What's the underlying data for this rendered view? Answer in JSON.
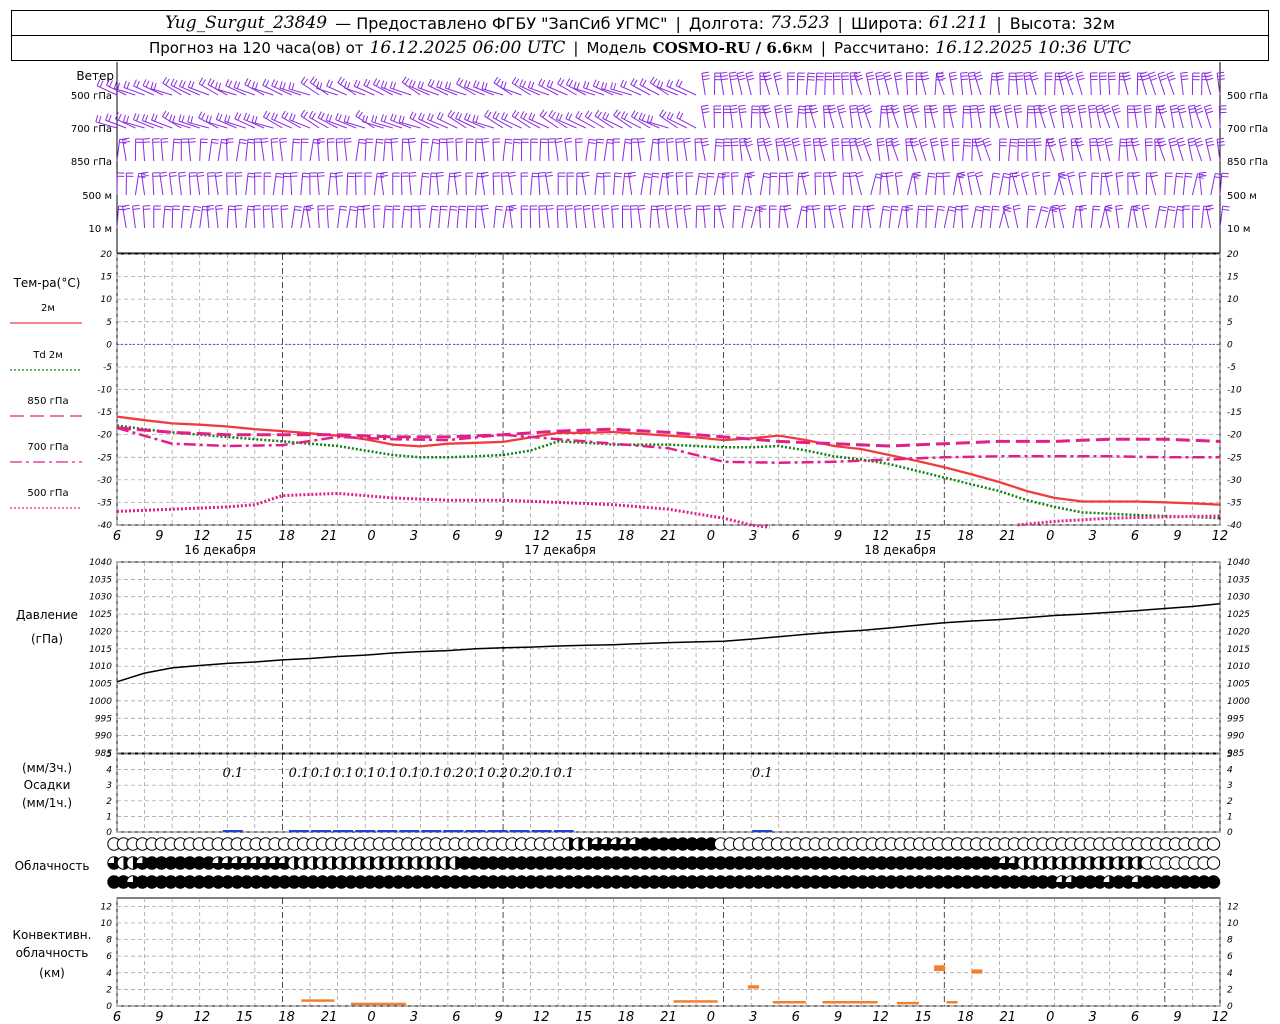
{
  "header": {
    "station": "Yug_Surgut_23849",
    "provider": "— Предоставлено ФГБУ \"ЗапСиб УГМС\"",
    "lon_label": "Долгота:",
    "lon": "73.523",
    "lat_label": "Широта:",
    "lat": "61.211",
    "alt_label": "Высота:",
    "alt": "32м",
    "forecast_prefix": "Прогноз на 120 часа(ов) от",
    "forecast_start": "16.12.2025 06:00 UTC",
    "model_label": "Модель",
    "model": "COSMO-RU / 6.6",
    "model_unit": "км",
    "computed_label": "Рассчитано:",
    "computed": "16.12.2025 10:36 UTC"
  },
  "labels": {
    "wind_title": "Ветер",
    "wind_levels": [
      "500 гПа",
      "700 гПа",
      "850 гПа",
      "500 м",
      "10 м"
    ],
    "temp_title": "Тем-ра(°C)",
    "t2m": "2м",
    "td_sym": "Td",
    "td_lvl": "2м",
    "t850": "850 гПа",
    "t700": "700 гПа",
    "t500": "500 гПа",
    "pressure_title": "Давление",
    "pressure_unit": "(гПа)",
    "precip_unit3": "(мм/3ч.)",
    "precip_title": "Осадки",
    "precip_unit1": "(мм/1ч.)",
    "cloud_title": "Облачность",
    "conv_title1": "Конвективн.",
    "conv_title2": "облачность",
    "conv_unit": "(км)"
  },
  "colors": {
    "t2m": "#f03c3c",
    "td": "#108010",
    "t850": "#e0208a",
    "wind": "#8a2be2",
    "zero": "#3050ff",
    "pressure": "#000000",
    "precip": "#2040d0",
    "conv": "#f08030"
  },
  "chart_data": [
    {
      "type": "line",
      "title": "Тем-ра(°C)",
      "x_ticks": [
        "6",
        "9",
        "12",
        "15",
        "18",
        "21",
        "0",
        "3",
        "6",
        "9",
        "12",
        "15",
        "18",
        "21",
        "0",
        "3",
        "6",
        "9",
        "12",
        "15",
        "18",
        "21",
        "0",
        "3",
        "6",
        "9",
        "12"
      ],
      "day_labels": [
        "16 декабря",
        "17 декабря",
        "18 декабря"
      ],
      "ylim": [
        -40,
        20
      ],
      "y_ticks": [
        20,
        15,
        10,
        5,
        0,
        -5,
        -10,
        -15,
        -20,
        -25,
        -30,
        -35,
        -40
      ],
      "series": [
        {
          "name": "2м",
          "x": [
            0,
            3,
            6,
            9,
            12,
            15,
            18,
            21,
            24,
            27,
            30,
            33,
            36,
            39,
            42,
            45,
            48,
            51,
            54,
            57,
            60,
            63,
            66,
            69,
            72,
            75,
            78,
            81,
            84,
            87,
            90,
            93,
            96,
            99,
            102,
            105,
            108,
            111,
            114,
            117,
            120
          ],
          "values": [
            -16,
            -16.8,
            -17.5,
            -17.8,
            -18.2,
            -18.8,
            -19.2,
            -19.7,
            -20.2,
            -21,
            -22.2,
            -22.6,
            -22,
            -21.8,
            -21.6,
            -20.6,
            -19.6,
            -19.6,
            -19.4,
            -19.8,
            -20.2,
            -20.6,
            -21.2,
            -20.8,
            -20.2,
            -21.2,
            -22.5,
            -23.2,
            -24.5,
            -25.8,
            -27.2,
            -28.8,
            -30.5,
            -32.5,
            -34,
            -34.8,
            -34.8,
            -34.8,
            -35,
            -35.2,
            -35.5
          ]
        },
        {
          "name": "Td 2м",
          "x": [
            0,
            3,
            6,
            9,
            12,
            15,
            18,
            21,
            24,
            27,
            30,
            33,
            36,
            39,
            42,
            45,
            48,
            51,
            54,
            57,
            60,
            63,
            66,
            69,
            72,
            75,
            78,
            81,
            84,
            87,
            90,
            93,
            96,
            99,
            102,
            105,
            108,
            111,
            114,
            117,
            120
          ],
          "values": [
            -18,
            -18.8,
            -19.5,
            -20,
            -20.5,
            -21,
            -21.5,
            -22,
            -22.5,
            -23.5,
            -24.5,
            -25,
            -25,
            -24.8,
            -24.5,
            -23.5,
            -21.5,
            -21.8,
            -22.2,
            -22.2,
            -22.2,
            -22.5,
            -22.8,
            -22.8,
            -22.5,
            -23.5,
            -24.8,
            -25.5,
            -26.5,
            -28,
            -29.5,
            -31,
            -32.5,
            -34.5,
            -36,
            -37.2,
            -37.5,
            -37.8,
            -38,
            -38.2,
            -38.5
          ]
        },
        {
          "name": "850 гПа",
          "x": [
            0,
            6,
            12,
            18,
            24,
            30,
            36,
            42,
            48,
            54,
            60,
            66,
            72,
            78,
            84,
            90,
            96,
            102,
            108,
            114,
            120
          ],
          "values": [
            -18.5,
            -19.5,
            -20,
            -20,
            -20,
            -20.5,
            -20.5,
            -20,
            -19.2,
            -18.8,
            -19.5,
            -20.5,
            -21.5,
            -22,
            -22.5,
            -22,
            -21.5,
            -21.5,
            -21,
            -21,
            -21.5
          ]
        },
        {
          "name": "700 гПа",
          "x": [
            0,
            6,
            12,
            18,
            24,
            30,
            36,
            42,
            48,
            54,
            60,
            66,
            72,
            78,
            84,
            90,
            96,
            102,
            108,
            114,
            120
          ],
          "values": [
            -18.5,
            -22,
            -22.5,
            -22.3,
            -20.5,
            -21,
            -21.2,
            -20,
            -21,
            -22,
            -23,
            -26,
            -26.2,
            -26,
            -25.5,
            -25,
            -24.8,
            -24.8,
            -24.8,
            -25,
            -25
          ]
        },
        {
          "name": "500 гПа",
          "x": [
            0,
            6,
            12,
            15,
            18,
            24,
            30,
            36,
            42,
            48,
            54,
            60,
            66,
            69,
            71
          ],
          "values": [
            -37,
            -36.5,
            -36,
            -35.5,
            -33.5,
            -33,
            -34,
            -34.5,
            -34.5,
            -35,
            -35.5,
            -36.5,
            -38.5,
            -40,
            -41
          ]
        },
        {
          "name": "500 гПа (2)",
          "x": [
            98,
            102,
            108,
            114,
            120
          ],
          "values": [
            -40,
            -39.2,
            -38.5,
            -38.2,
            -38
          ]
        }
      ]
    },
    {
      "type": "line",
      "title": "Давление",
      "ylabel": "(гПа)",
      "ylim": [
        985,
        1040
      ],
      "y_ticks": [
        1040,
        1035,
        1030,
        1025,
        1020,
        1015,
        1010,
        1005,
        1000,
        995,
        990,
        985
      ],
      "series": [
        {
          "name": "Давление",
          "x": [
            0,
            3,
            6,
            9,
            12,
            15,
            18,
            21,
            24,
            27,
            30,
            33,
            36,
            39,
            42,
            45,
            48,
            51,
            54,
            57,
            60,
            63,
            66,
            69,
            72,
            75,
            78,
            81,
            84,
            87,
            90,
            93,
            96,
            99,
            102,
            105,
            108,
            111,
            114,
            117,
            120
          ],
          "values": [
            1005.5,
            1008,
            1009.5,
            1010.2,
            1010.8,
            1011.2,
            1011.8,
            1012.2,
            1012.8,
            1013.2,
            1013.8,
            1014.2,
            1014.5,
            1015,
            1015.3,
            1015.5,
            1015.8,
            1016,
            1016.2,
            1016.5,
            1016.8,
            1017,
            1017.2,
            1017.8,
            1018.5,
            1019.2,
            1019.8,
            1020.3,
            1021,
            1021.8,
            1022.5,
            1023,
            1023.4,
            1024,
            1024.6,
            1025,
            1025.5,
            1026,
            1026.6,
            1027.2,
            1028
          ]
        }
      ]
    },
    {
      "type": "bar",
      "title": "Осадки",
      "ylabel": "(мм/3ч.) (мм/1ч.)",
      "ylim": [
        0,
        5
      ],
      "y_ticks": [
        5,
        4,
        3,
        2,
        1,
        0
      ],
      "totals_3h": [
        {
          "x": 12,
          "value": "0.1"
        },
        {
          "x": 21,
          "value": "0.1"
        },
        {
          "x": 24,
          "value": "0.1"
        },
        {
          "x": 27,
          "value": "0.1"
        },
        {
          "x": 30,
          "value": "0.1"
        },
        {
          "x": 33,
          "value": "0.1"
        },
        {
          "x": 36,
          "value": "0.1"
        },
        {
          "x": 39,
          "value": "0.1"
        },
        {
          "x": 42,
          "value": "0.2"
        },
        {
          "x": 45,
          "value": "0.1"
        },
        {
          "x": 48,
          "value": "0.2"
        },
        {
          "x": 51,
          "value": "0.2"
        },
        {
          "x": 54,
          "value": "0.1"
        },
        {
          "x": 57,
          "value": "0.1"
        },
        {
          "x": 84,
          "value": "0.1"
        }
      ]
    },
    {
      "type": "table",
      "title": "Облачность",
      "rows": [
        "000000000000000000000000000000000000000000000000222333334444444400000000000000000000000000000000000000000000000000000",
        "322344444443333333322222222222222222244444444444444444444444444444444444444444444444444444444433222222222222200000000",
        "443444444444444444444444444444444444444444444444444444444444444444444444444444444444444444444444444433444344344444444"
      ]
    },
    {
      "type": "bar",
      "title": "Конвективн. облачность",
      "ylabel": "(км)",
      "ylim": [
        0,
        13
      ],
      "y_ticks": [
        12,
        10,
        8,
        6,
        4,
        2,
        0
      ],
      "segments": [
        {
          "x0": 13,
          "x1": 16,
          "base": 0.5,
          "top": 0.8
        },
        {
          "x0": 17,
          "x1": 22,
          "base": 0.3,
          "top": 0.4
        },
        {
          "x0": 43,
          "x1": 47,
          "base": 0.4,
          "top": 0.7
        },
        {
          "x0": 49,
          "x1": 50,
          "base": 2.1,
          "top": 2.5
        },
        {
          "x0": 51,
          "x1": 54,
          "base": 0.4,
          "top": 0.6
        },
        {
          "x0": 55,
          "x1": 60,
          "base": 0.4,
          "top": 0.6
        },
        {
          "x0": 61,
          "x1": 63,
          "base": 0.4,
          "top": 0.5
        },
        {
          "x0": 64,
          "x1": 65,
          "base": 4.2,
          "top": 4.9
        },
        {
          "x0": 65,
          "x1": 66,
          "base": 0.5,
          "top": 0.6
        },
        {
          "x0": 67,
          "x1": 68,
          "base": 3.9,
          "top": 4.4
        }
      ]
    }
  ]
}
